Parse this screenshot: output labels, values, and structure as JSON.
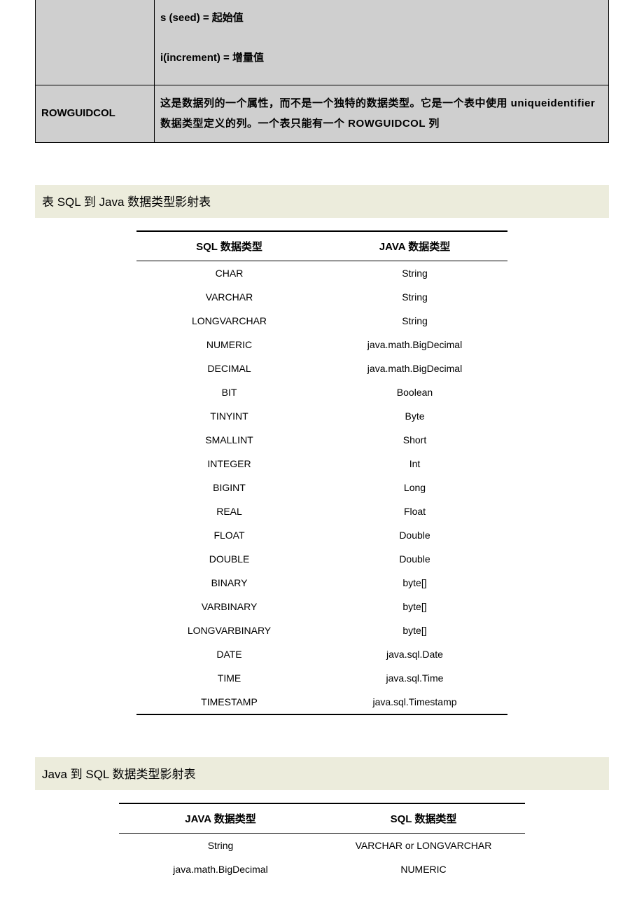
{
  "def_table": {
    "rows": [
      {
        "label": "",
        "desc_line1": "s (seed) = 起始值",
        "desc_line2": "i(increment) = 增量值"
      },
      {
        "label": "ROWGUIDCOL",
        "desc": "这是数据列的一个属性，而不是一个独特的数据类型。它是一个表中使用 uniqueidentifier 数据类型定义的列。一个表只能有一个 ROWGUIDCOL 列"
      }
    ]
  },
  "section1": {
    "title": "表 SQL 到 Java 数据类型影射表",
    "headers": {
      "c0": "SQL 数据类型",
      "c1": "JAVA 数据类型"
    },
    "rows": [
      {
        "sql": "CHAR",
        "java": "String"
      },
      {
        "sql": "VARCHAR",
        "java": "String"
      },
      {
        "sql": "LONGVARCHAR",
        "java": "String"
      },
      {
        "sql": "NUMERIC",
        "java": "java.math.BigDecimal"
      },
      {
        "sql": "DECIMAL",
        "java": "java.math.BigDecimal"
      },
      {
        "sql": "BIT",
        "java": "Boolean"
      },
      {
        "sql": "TINYINT",
        "java": "Byte"
      },
      {
        "sql": "SMALLINT",
        "java": "Short"
      },
      {
        "sql": "INTEGER",
        "java": "Int"
      },
      {
        "sql": "BIGINT",
        "java": "Long"
      },
      {
        "sql": "REAL",
        "java": "Float"
      },
      {
        "sql": "FLOAT",
        "java": "Double"
      },
      {
        "sql": "DOUBLE",
        "java": "Double"
      },
      {
        "sql": "BINARY",
        "java": "byte[]"
      },
      {
        "sql": "VARBINARY",
        "java": "byte[]"
      },
      {
        "sql": "LONGVARBINARY",
        "java": "byte[]"
      },
      {
        "sql": "DATE",
        "java": "java.sql.Date"
      },
      {
        "sql": "TIME",
        "java": "java.sql.Time"
      },
      {
        "sql": "TIMESTAMP",
        "java": "java.sql.Timestamp"
      }
    ]
  },
  "section2": {
    "title": "Java 到 SQL 数据类型影射表",
    "headers": {
      "c0": "JAVA 数据类型",
      "c1": "SQL 数据类型"
    },
    "rows": [
      {
        "java": "String",
        "sql": "VARCHAR or LONGVARCHAR"
      },
      {
        "java": "java.math.BigDecimal",
        "sql": "NUMERIC"
      }
    ]
  }
}
